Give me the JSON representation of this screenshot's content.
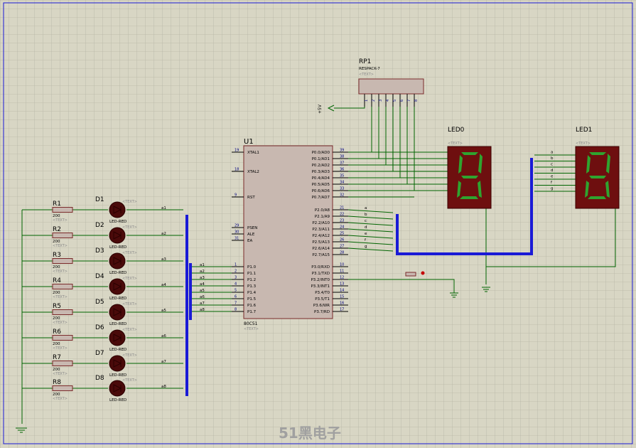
{
  "u1": {
    "ref": "U1",
    "part": "80C51",
    "text_tag": "<TEXT>",
    "left_pins": [
      {
        "num": "19",
        "name": "XTAL1"
      },
      {
        "num": "18",
        "name": "XTAL2"
      },
      {
        "num": "9",
        "name": "RST"
      },
      {
        "num": "29",
        "name": "PSEN"
      },
      {
        "num": "30",
        "name": "ALE"
      },
      {
        "num": "31",
        "name": "EA"
      },
      {
        "num": "1",
        "name": "P1.0"
      },
      {
        "num": "2",
        "name": "P1.1"
      },
      {
        "num": "3",
        "name": "P1.2"
      },
      {
        "num": "4",
        "name": "P1.3"
      },
      {
        "num": "5",
        "name": "P1.4"
      },
      {
        "num": "6",
        "name": "P1.5"
      },
      {
        "num": "7",
        "name": "P1.6"
      },
      {
        "num": "8",
        "name": "P1.7"
      }
    ],
    "right_pins": [
      {
        "num": "39",
        "name": "P0.0/AD0"
      },
      {
        "num": "38",
        "name": "P0.1/AD1"
      },
      {
        "num": "37",
        "name": "P0.2/AD2"
      },
      {
        "num": "36",
        "name": "P0.3/AD3"
      },
      {
        "num": "35",
        "name": "P0.4/AD4"
      },
      {
        "num": "34",
        "name": "P0.5/AD5"
      },
      {
        "num": "33",
        "name": "P0.6/AD6"
      },
      {
        "num": "32",
        "name": "P0.7/AD7"
      },
      {
        "num": "21",
        "name": "P2.0/A8"
      },
      {
        "num": "22",
        "name": "P2.1/A9"
      },
      {
        "num": "23",
        "name": "P2.2/A10"
      },
      {
        "num": "24",
        "name": "P2.3/A11"
      },
      {
        "num": "25",
        "name": "P2.4/A12"
      },
      {
        "num": "26",
        "name": "P2.5/A13"
      },
      {
        "num": "27",
        "name": "P2.6/A14"
      },
      {
        "num": "28",
        "name": "P2.7/A15"
      },
      {
        "num": "10",
        "name": "P3.0/RXD"
      },
      {
        "num": "11",
        "name": "P3.1/TXD"
      },
      {
        "num": "12",
        "name": "P3.2/INT0"
      },
      {
        "num": "13",
        "name": "P3.3/INT1"
      },
      {
        "num": "14",
        "name": "P3.4/T0"
      },
      {
        "num": "15",
        "name": "P3.5/T1"
      },
      {
        "num": "16",
        "name": "P3.6/WR"
      },
      {
        "num": "17",
        "name": "P3.7/RD"
      }
    ]
  },
  "rp1": {
    "ref": "RP1",
    "part": "RESPACK-7",
    "text_tag": "<TEXT>",
    "pins": [
      "1",
      "2",
      "3",
      "4",
      "5",
      "6",
      "7",
      "8"
    ],
    "supply": "+5V"
  },
  "led0": {
    "ref": "LED0",
    "digit": "8",
    "text_tag": "<TEXT>"
  },
  "led1": {
    "ref": "LED1",
    "digit": "8",
    "text_tag": "<TEXT>"
  },
  "led_rows": [
    {
      "r": "R1",
      "rv": "200",
      "rt": "<TEXT>",
      "d": "D1",
      "dt": "<TEXT>",
      "dv": "LED-RED",
      "net": "a1"
    },
    {
      "r": "R2",
      "rv": "200",
      "rt": "<TEXT>",
      "d": "D2",
      "dt": "<TEXT>",
      "dv": "LED-RED",
      "net": "a2"
    },
    {
      "r": "R3",
      "rv": "200",
      "rt": "<TEXT>",
      "d": "D3",
      "dt": "<TEXT>",
      "dv": "LED-RED",
      "net": "a3"
    },
    {
      "r": "R4",
      "rv": "200",
      "rt": "<TEXT>",
      "d": "D4",
      "dt": "<TEXT>",
      "dv": "LED-RED",
      "net": "a4"
    },
    {
      "r": "R5",
      "rv": "200",
      "rt": "<TEXT>",
      "d": "D5",
      "dt": "<TEXT>",
      "dv": "LED-RED",
      "net": "a5"
    },
    {
      "r": "R6",
      "rv": "200",
      "rt": "<TEXT>",
      "d": "D6",
      "dt": "<TEXT>",
      "dv": "LED-RED",
      "net": "a6"
    },
    {
      "r": "R7",
      "rv": "200",
      "rt": "<TEXT>",
      "d": "D7",
      "dt": "<TEXT>",
      "dv": "LED-RED",
      "net": "a7"
    },
    {
      "r": "R8",
      "rv": "200",
      "rt": "<TEXT>",
      "d": "D8",
      "dt": "<TEXT>",
      "dv": "LED-RED",
      "net": "a8"
    }
  ],
  "p1_nets": [
    "a1",
    "a2",
    "a3",
    "a4",
    "a5",
    "a6",
    "a7",
    "a8"
  ],
  "seg_nets": [
    "a",
    "b",
    "c",
    "d",
    "e",
    "f",
    "g"
  ],
  "watermark": "51黑电子",
  "colors": {
    "background": "#d8d6c4",
    "grid": "#b7b5a6",
    "wire": "#006400",
    "bus": "#1a1ad6",
    "chip_fill": "#c8b8b0",
    "chip_border": "#7a2a2a",
    "pin_text": "#000080",
    "segment_display": "#6e0f0f",
    "segment_lit": "#2fa42f",
    "led_dark": "#4a0a0a",
    "text_tag": "#8a8a8a"
  }
}
